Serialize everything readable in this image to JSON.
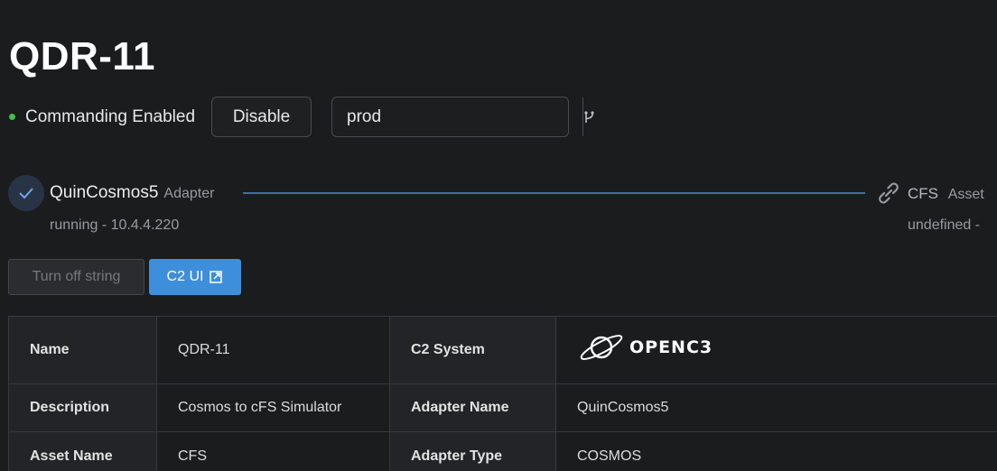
{
  "page": {
    "title": "QDR-11"
  },
  "status": {
    "commanding_text": "Commanding Enabled",
    "commanding_color": "#3ec24a",
    "disable_label": "Disable",
    "branch_value": "prod",
    "branch_icon": "git-branch-icon"
  },
  "pipeline": {
    "adapter": {
      "name": "QuinCosmos5",
      "tag": "Adapter",
      "status": "running - 10.4.4.220",
      "icon": "check-icon"
    },
    "asset": {
      "name": "CFS",
      "tag": "Asset",
      "status": "undefined -",
      "icon": "link-icon"
    },
    "line_color": "#3f6fa8"
  },
  "actions": {
    "turn_off_label": "Turn off string",
    "c2ui_label": "C2 UI",
    "c2ui_icon": "open-external-icon",
    "accent_color": "#3d8fdb"
  },
  "details": {
    "rows": [
      {
        "label1": "Name",
        "value1": "QDR-11",
        "label2": "C2 System",
        "value2": ""
      },
      {
        "label1": "Description",
        "value1": "Cosmos to cFS Simulator",
        "label2": "Adapter Name",
        "value2": "QuinCosmos5"
      },
      {
        "label1": "Asset Name",
        "value1": "CFS",
        "label2": "Adapter Type",
        "value2": "COSMOS"
      }
    ],
    "c2_logo_text": "OPENC3"
  }
}
